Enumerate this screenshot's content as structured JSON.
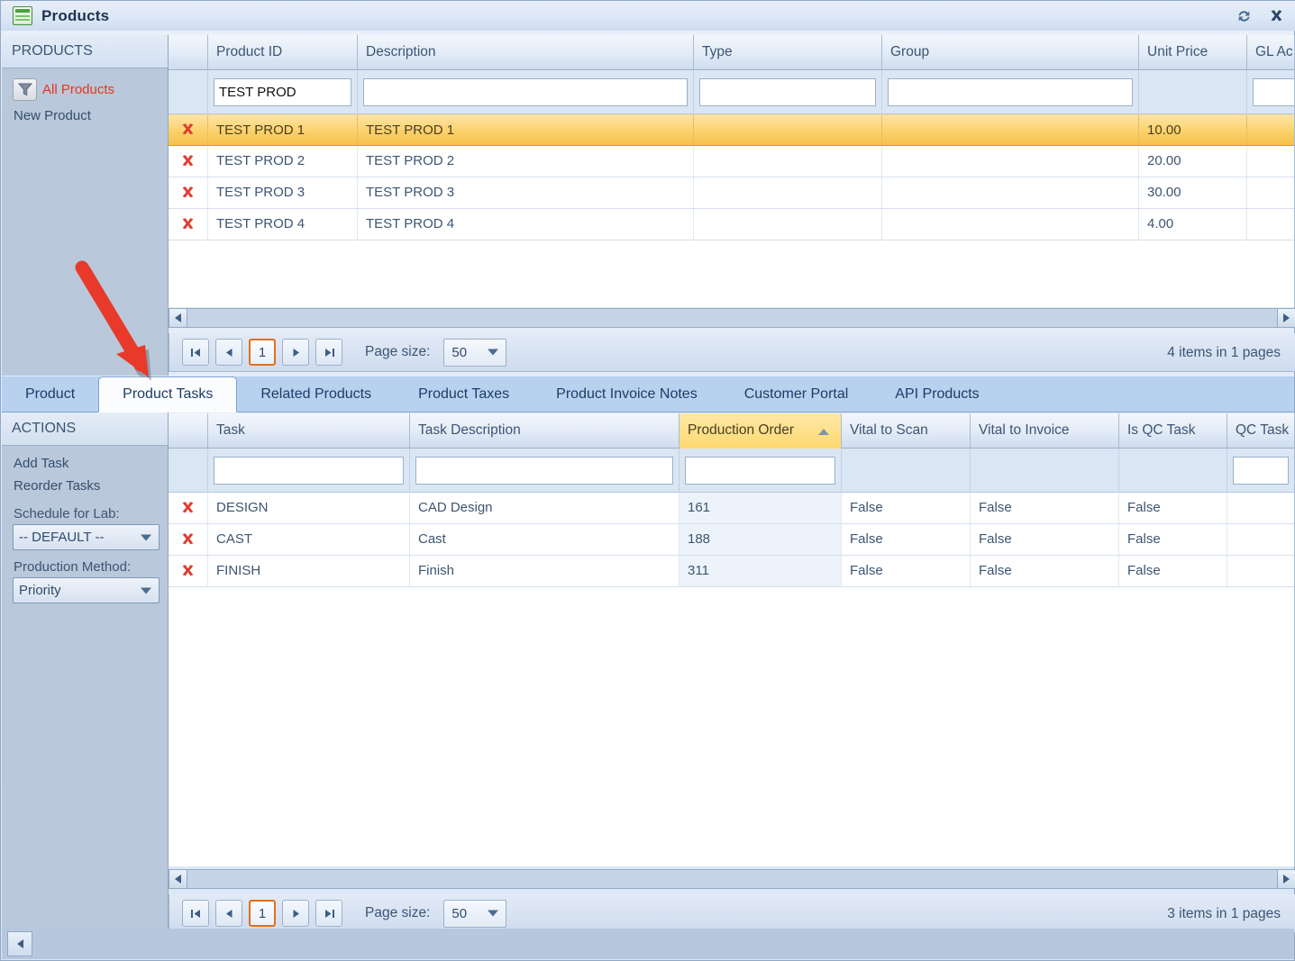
{
  "window": {
    "title": "Products",
    "icon": "grid-document-icon",
    "refresh_icon": "refresh-icon",
    "close_icon": "close-icon"
  },
  "products_sidebar": {
    "header": "PRODUCTS",
    "filter_icon": "filter-funnel-icon",
    "items": [
      {
        "label": "All Products",
        "accent": "#e8361b"
      },
      {
        "label": "New Product",
        "accent": "#334e6e"
      }
    ]
  },
  "actions_sidebar": {
    "header": "ACTIONS",
    "items": [
      {
        "label": "Add Task"
      },
      {
        "label": "Reorder Tasks"
      }
    ],
    "schedule_label": "Schedule for Lab:",
    "schedule_value": "-- DEFAULT --",
    "production_method_label": "Production Method:",
    "production_method_value": "Priority"
  },
  "products_grid": {
    "columns": [
      "Product ID",
      "Description",
      "Type",
      "Group",
      "Unit Price",
      "GL Ac"
    ],
    "filter_values": {
      "product_id": "TEST PROD",
      "description": "",
      "type": "",
      "group": "",
      "gl_account": ""
    },
    "delete_icon": "delete-x-icon",
    "rows": [
      {
        "product_id": "TEST PROD 1",
        "description": "TEST PROD 1",
        "type": "",
        "group": "",
        "unit_price": "10.00",
        "gl_account": "",
        "selected": true
      },
      {
        "product_id": "TEST PROD 2",
        "description": "TEST PROD 2",
        "type": "",
        "group": "",
        "unit_price": "20.00",
        "gl_account": "",
        "selected": false
      },
      {
        "product_id": "TEST PROD 3",
        "description": "TEST PROD 3",
        "type": "",
        "group": "",
        "unit_price": "30.00",
        "gl_account": "",
        "selected": false
      },
      {
        "product_id": "TEST PROD 4",
        "description": "TEST PROD 4",
        "type": "",
        "group": "",
        "unit_price": "4.00",
        "gl_account": "",
        "selected": false
      }
    ],
    "pager": {
      "first_icon": "first-page-icon",
      "prev_icon": "previous-page-icon",
      "current_page": "1",
      "next_icon": "next-page-icon",
      "last_icon": "last-page-icon",
      "page_size_label": "Page size:",
      "page_size_value": "50",
      "info": "4 items in 1 pages"
    }
  },
  "tabs": [
    {
      "label": "Product",
      "active": false
    },
    {
      "label": "Product Tasks",
      "active": true
    },
    {
      "label": "Related Products",
      "active": false
    },
    {
      "label": "Product Taxes",
      "active": false
    },
    {
      "label": "Product Invoice Notes",
      "active": false
    },
    {
      "label": "Customer Portal",
      "active": false
    },
    {
      "label": "API Products",
      "active": false
    }
  ],
  "tasks_grid": {
    "columns": [
      "Task",
      "Task Description",
      "Production Order",
      "Vital to Scan",
      "Vital to Invoice",
      "Is QC Task",
      "QC Task"
    ],
    "sorted_column": "Production Order",
    "sort_direction": "ascending",
    "sort_icon": "sort-ascending-icon",
    "filter_values": {
      "task": "",
      "task_description": "",
      "production_order": "",
      "qc_task": ""
    },
    "delete_icon": "delete-x-icon",
    "rows": [
      {
        "task": "DESIGN",
        "task_description": "CAD Design",
        "production_order": "161",
        "vital_to_scan": "False",
        "vital_to_invoice": "False",
        "is_qc_task": "False",
        "qc_task": ""
      },
      {
        "task": "CAST",
        "task_description": "Cast",
        "production_order": "188",
        "vital_to_scan": "False",
        "vital_to_invoice": "False",
        "is_qc_task": "False",
        "qc_task": ""
      },
      {
        "task": "FINISH",
        "task_description": "Finish",
        "production_order": "311",
        "vital_to_scan": "False",
        "vital_to_invoice": "False",
        "is_qc_task": "False",
        "qc_task": ""
      }
    ],
    "pager": {
      "first_icon": "first-page-icon",
      "prev_icon": "previous-page-icon",
      "current_page": "1",
      "next_icon": "next-page-icon",
      "last_icon": "last-page-icon",
      "page_size_label": "Page size:",
      "page_size_value": "50",
      "info": "3 items in 1 pages"
    }
  },
  "annotation": {
    "type": "red-arrow",
    "color": "#e8392a",
    "points_to": "Product Tasks tab"
  },
  "scrollbars": {
    "left_arrow_icon": "scroll-left-icon",
    "right_arrow_icon": "scroll-right-icon"
  }
}
